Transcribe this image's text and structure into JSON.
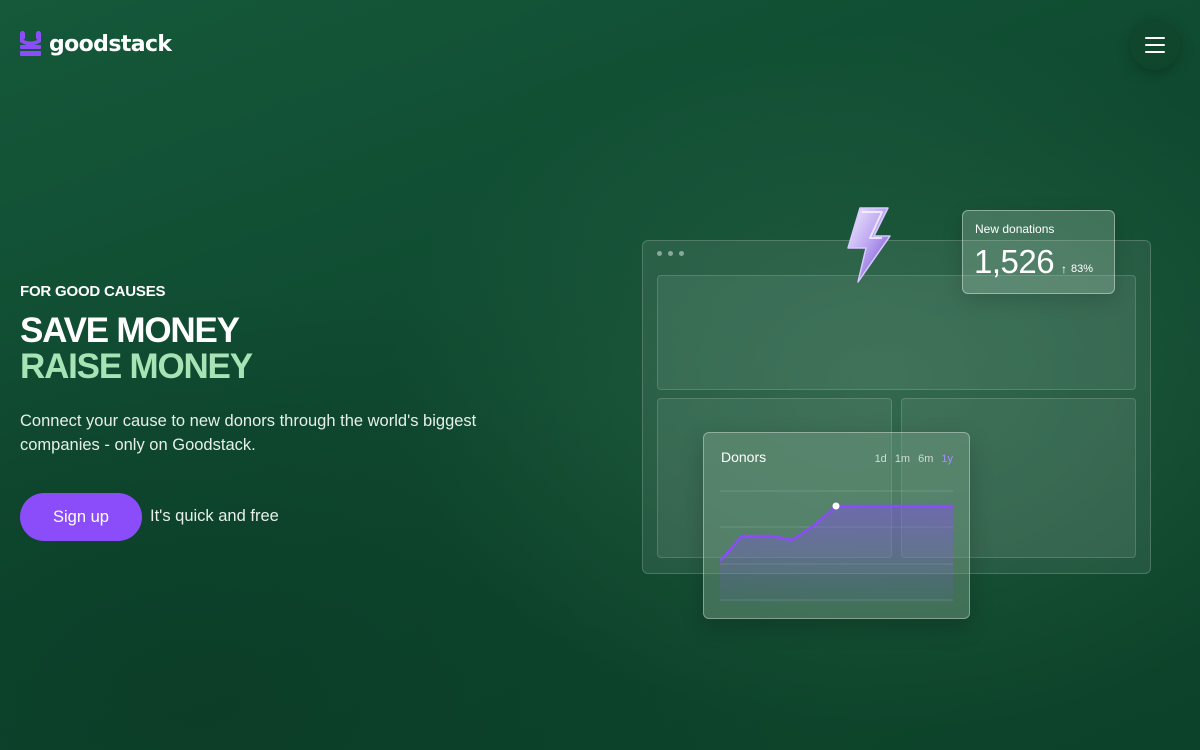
{
  "header": {
    "brand": "goodstack",
    "menu_icon": "hamburger-menu-icon"
  },
  "hero": {
    "eyebrow": "FOR GOOD CAUSES",
    "headline_line1": "SAVE MONEY",
    "headline_line2": "RAISE MONEY",
    "description": "Connect your cause to new donors through the world's biggest companies - only on Goodstack.",
    "cta_label": "Sign up",
    "cta_note": "It's quick and free"
  },
  "illustration": {
    "new_donations": {
      "label": "New donations",
      "value": "1,526",
      "change": "83%",
      "change_icon": "arrow-up-icon"
    },
    "donors_card": {
      "title": "Donors",
      "ranges": [
        "1d",
        "1m",
        "6m",
        "1y"
      ],
      "active_range": "1y"
    },
    "icons": [
      "lightning-bolt-icon"
    ]
  },
  "colors": {
    "background": "#12503a",
    "accent_purple": "#8b4dfa",
    "headline_green": "#a7e3b5",
    "active_range": "#a98cff"
  }
}
